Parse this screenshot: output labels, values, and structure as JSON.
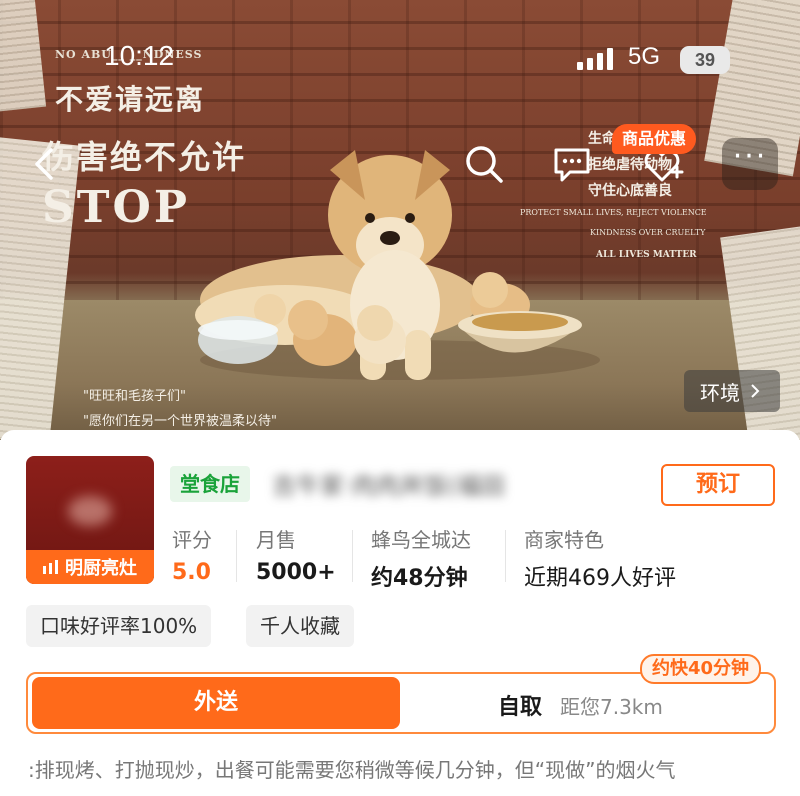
{
  "status_bar": {
    "time": "10:12",
    "network": "5G",
    "battery": "39"
  },
  "hero": {
    "poster": {
      "small_caption": "NO ABU__ __NDNESS",
      "headline_1": "不爱请远离",
      "headline_2": "伤害绝不允许",
      "stop": "STOP",
      "right_1": "生命",
      "right_2": "拒绝虐待动物",
      "right_3": "守住心底善良",
      "right_4": "PROTECT SMALL LIVES, REJECT VIOLENCE",
      "right_5": "KINDNESS OVER CRUELTY",
      "right_6": "ALL LIVES MATTER",
      "quote_1": "\"旺旺和毛孩子们\"",
      "quote_2": "\"愿你们在另一个世界被温柔以待\""
    },
    "promo_badge": "商品优惠",
    "environment_label": "环境",
    "icons": {
      "back": "back-arrow-icon",
      "search": "search-icon",
      "chat": "chat-icon",
      "favorite": "add-favorite-icon",
      "more": "more-icon"
    }
  },
  "store": {
    "logo_banner": "明厨亮灶",
    "dine_tag": "堂食店",
    "name": "吉牛家·肉肉丼饭(福田",
    "reserve_label": "预订",
    "stats": [
      {
        "label": "评分",
        "value": "5.0"
      },
      {
        "label": "月售",
        "value": "5000+"
      },
      {
        "label": "蜂鸟全城达",
        "value": "约48分钟"
      },
      {
        "label": "商家特色",
        "value": "近期469人好评"
      }
    ],
    "chips": [
      "口味好评率100%",
      "千人收藏"
    ],
    "delivery": {
      "delivery_label": "外送",
      "pickup_label": "自取",
      "pickup_distance": "距您7.3km",
      "faster_badge": "约快40分钟"
    },
    "description": ":排现烤、打抛现炒，出餐可能需要您稍微等候几分钟，但“现做”的烟火气"
  },
  "colors": {
    "accent": "#ff6a1a",
    "green": "#1aa33a",
    "logo_bg": "#6c1612"
  }
}
